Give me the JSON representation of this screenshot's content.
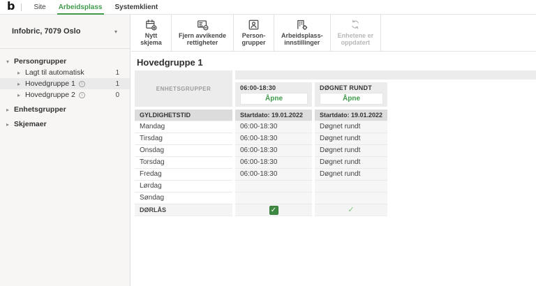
{
  "topbar": {
    "logo_glyph": "b",
    "tabs": [
      {
        "label": "Site"
      },
      {
        "label": "Arbeidsplass"
      },
      {
        "label": "Systemklient"
      }
    ]
  },
  "sidebar": {
    "org_name": "Infobric, 7079 Oslo",
    "tree": [
      {
        "label": "Persongrupper",
        "caret": "▾",
        "level": 0,
        "expanded": true
      },
      {
        "label": "Lagt til automatisk",
        "caret": "▸",
        "level": 1,
        "count": "1"
      },
      {
        "label": "Hovedgruppe 1",
        "caret": "▸",
        "level": 1,
        "count": "1",
        "info": true,
        "selected": true
      },
      {
        "label": "Hovedgruppe 2",
        "caret": "▸",
        "level": 1,
        "count": "0",
        "info": true
      },
      {
        "label": "Enhetsgrupper",
        "caret": "▸",
        "level": 0
      },
      {
        "label": "Skjemaer",
        "caret": "▸",
        "level": 0
      }
    ]
  },
  "toolbar": {
    "buttons": [
      {
        "icon": "new-form-icon",
        "line1": "Nytt",
        "line2": "skjema",
        "disabled": false
      },
      {
        "icon": "remove-deviating-rights-icon",
        "line1": "Fjern avvikende",
        "line2": "rettigheter",
        "disabled": false
      },
      {
        "icon": "person-groups-icon",
        "line1": "Person-",
        "line2": "grupper",
        "disabled": false
      },
      {
        "icon": "workplace-settings-icon",
        "line1": "Arbeidsplass-",
        "line2": "innstillinger",
        "disabled": false
      },
      {
        "icon": "refresh-icon",
        "line1": "Enhetene er",
        "line2": "oppdatert",
        "disabled": true
      }
    ]
  },
  "main": {
    "title": "Hovedgruppe 1",
    "table": {
      "corner_header": "ENHETSGRUPPER",
      "columns": [
        {
          "header": "06:00-18:30",
          "button_label": "Åpne"
        },
        {
          "header": "DØGNET RUNDT",
          "button_label": "Åpne"
        }
      ],
      "validity_row": {
        "label": "GYLDIGHETSTID",
        "values": [
          "Startdato: 19.01.2022",
          "Startdato: 19.01.2022"
        ]
      },
      "day_rows": [
        {
          "label": "Mandag",
          "values": [
            "06:00-18:30",
            "Døgnet rundt"
          ]
        },
        {
          "label": "Tirsdag",
          "values": [
            "06:00-18:30",
            "Døgnet rundt"
          ]
        },
        {
          "label": "Onsdag",
          "values": [
            "06:00-18:30",
            "Døgnet rundt"
          ]
        },
        {
          "label": "Torsdag",
          "values": [
            "06:00-18:30",
            "Døgnet rundt"
          ]
        },
        {
          "label": "Fredag",
          "values": [
            "06:00-18:30",
            "Døgnet rundt"
          ]
        },
        {
          "label": "Lørdag",
          "values": [
            "",
            ""
          ]
        },
        {
          "label": "Søndag",
          "values": [
            "",
            ""
          ]
        }
      ],
      "lock_row": {
        "label": "DØRLÅS",
        "checkbox_checked": true,
        "check_present": true
      }
    }
  },
  "icons": {
    "dropdown": "▾",
    "caret_down": "▾",
    "caret_right": "▸",
    "info": "i",
    "check": "✓"
  },
  "colors": {
    "accent_green": "#3f9b4b",
    "checkbox_green": "#3f8a43",
    "check_light_green": "#80c584",
    "header_gray": "#ececec",
    "validity_row_gray": "#dcdcdc"
  }
}
